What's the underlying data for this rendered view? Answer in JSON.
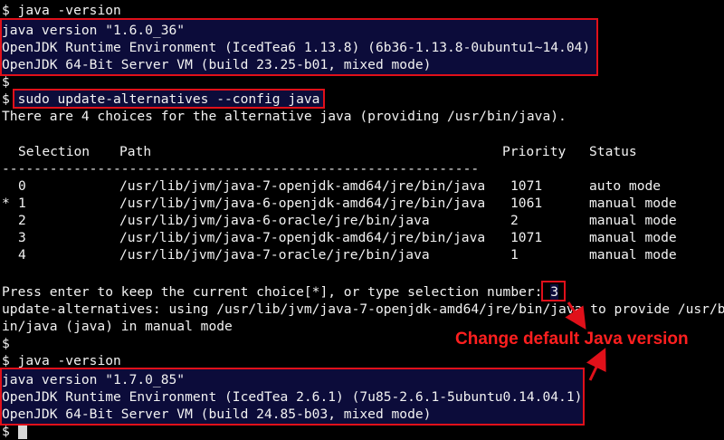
{
  "prompt": "$",
  "block1": {
    "command": " java -version",
    "out": [
      "java version \"1.6.0_36\"",
      "OpenJDK Runtime Environment (IcedTea6 1.13.8) (6b36-1.13.8-0ubuntu1~14.04)",
      "OpenJDK 64-Bit Server VM (build 23.25-b01, mixed mode)"
    ]
  },
  "block2": {
    "command": " sudo update-alternatives --config java",
    "intro": "There are 4 choices for the alternative java (providing /usr/bin/java).",
    "headers": [
      "Selection",
      "Path",
      "Priority",
      "Status"
    ],
    "rule": "------------------------------------------------------------",
    "rows": [
      {
        "marker": "",
        "sel": "0",
        "path": "/usr/lib/jvm/java-7-openjdk-amd64/jre/bin/java",
        "priority": "1071",
        "status": "auto mode"
      },
      {
        "marker": "*",
        "sel": "1",
        "path": "/usr/lib/jvm/java-6-openjdk-amd64/jre/bin/java",
        "priority": "1061",
        "status": "manual mode"
      },
      {
        "marker": "",
        "sel": "2",
        "path": "/usr/lib/jvm/java-6-oracle/jre/bin/java",
        "priority": "2",
        "status": "manual mode"
      },
      {
        "marker": "",
        "sel": "3",
        "path": "/usr/lib/jvm/java-7-openjdk-amd64/jre/bin/java",
        "priority": "1071",
        "status": "manual mode"
      },
      {
        "marker": "",
        "sel": "4",
        "path": "/usr/lib/jvm/java-7-oracle/jre/bin/java",
        "priority": "1",
        "status": "manual mode"
      }
    ],
    "press_enter": "Press enter to keep the current choice[*], or type selection number: ",
    "typed_selection": "3",
    "result1": "update-alternatives: using /usr/lib/jvm/java-7-openjdk-amd64/jre/bin/java to provide /usr/b",
    "result2": "in/java (java) in manual mode"
  },
  "block3": {
    "command": " java -version",
    "out": [
      "java version \"1.7.0_85\"",
      "OpenJDK Runtime Environment (IcedTea 2.6.1) (7u85-2.6.1-5ubuntu0.14.04.1)",
      "OpenJDK 64-Bit Server VM (build 24.85-b03, mixed mode)"
    ]
  },
  "annotation": "Change default Java version",
  "colors": {
    "background": "#000000",
    "text": "#f2f2f2",
    "highlight": "#0c0c3a",
    "annotation": "#ff1f1f"
  },
  "icons": [
    "arrow-icon",
    "cursor-block"
  ]
}
